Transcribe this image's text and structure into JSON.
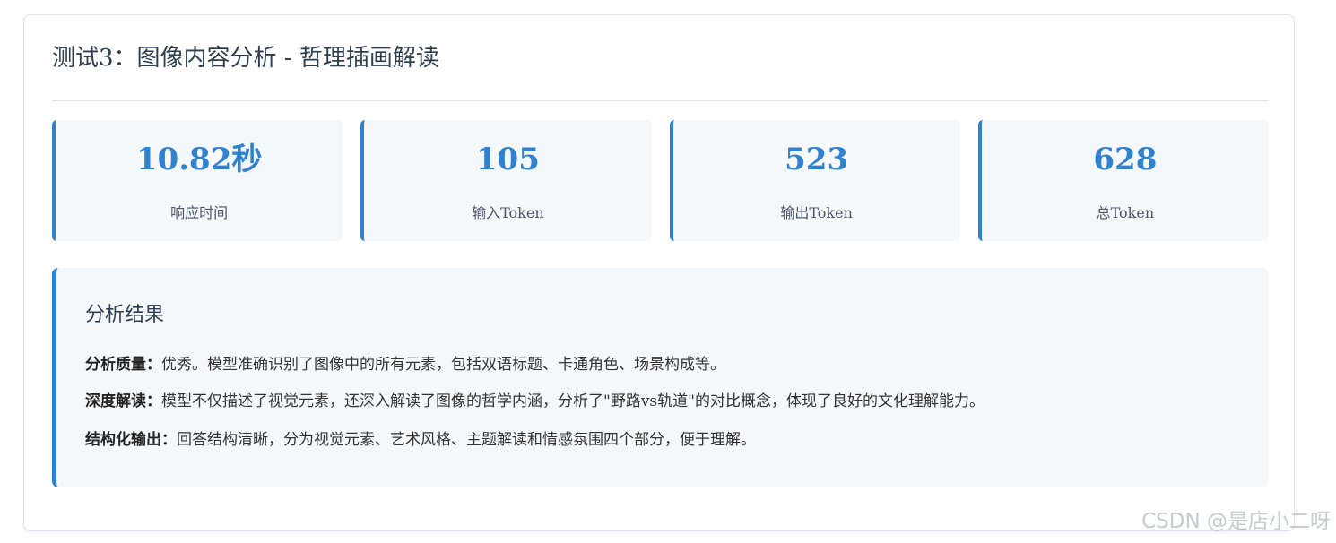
{
  "header": {
    "title": "测试3：图像内容分析 - 哲理插画解读"
  },
  "stats": [
    {
      "value": "10.82秒",
      "label": "响应时间"
    },
    {
      "value": "105",
      "label": "输入Token"
    },
    {
      "value": "523",
      "label": "输出Token"
    },
    {
      "value": "628",
      "label": "总Token"
    }
  ],
  "result": {
    "title": "分析结果",
    "items": [
      {
        "label": "分析质量：",
        "text": "优秀。模型准确识别了图像中的所有元素，包括双语标题、卡通角色、场景构成等。"
      },
      {
        "label": "深度解读：",
        "text": "模型不仅描述了视觉元素，还深入解读了图像的哲学内涵，分析了\"野路vs轨道\"的对比概念，体现了良好的文化理解能力。"
      },
      {
        "label": "结构化输出：",
        "text": "回答结构清晰，分为视觉元素、艺术风格、主题解读和情感氛围四个部分，便于理解。"
      }
    ]
  },
  "watermark": "CSDN @是店小二呀",
  "colors": {
    "accent": "#3182ce",
    "panel_bg": "#f5f8fb",
    "text": "#2c3e50"
  }
}
